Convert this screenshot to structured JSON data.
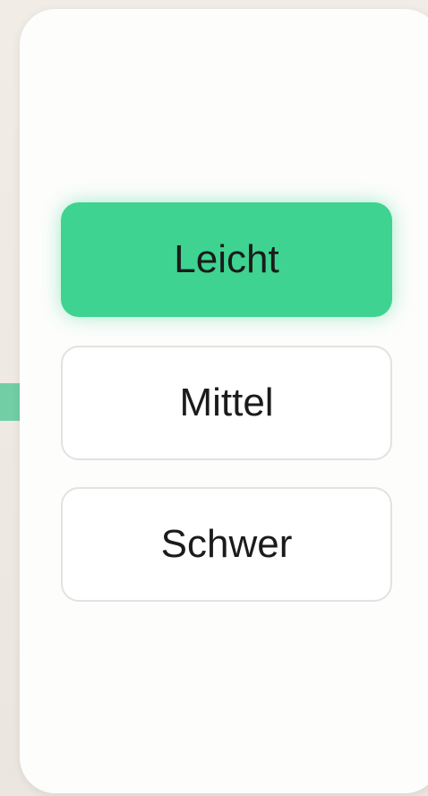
{
  "difficulty": {
    "options": [
      {
        "label": "Leicht",
        "selected": true
      },
      {
        "label": "Mittel",
        "selected": false
      },
      {
        "label": "Schwer",
        "selected": false
      }
    ]
  },
  "colors": {
    "background": "#ede8e2",
    "panel": "#fdfdfc",
    "selected": "#3ed390",
    "border": "#e2e2e2",
    "text": "#1b1b1b"
  }
}
